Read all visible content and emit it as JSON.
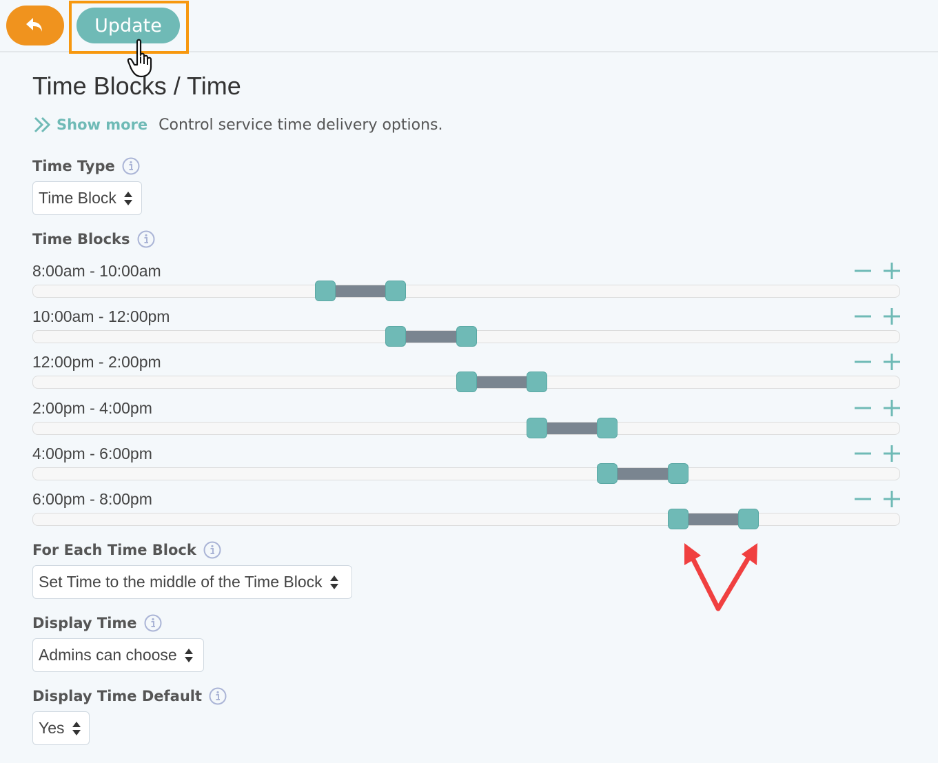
{
  "toolbar": {
    "update_label": "Update"
  },
  "page": {
    "title": "Time Blocks / Time",
    "show_more": "Show more",
    "description": "Control service time delivery options."
  },
  "time_type": {
    "label": "Time Type",
    "value": "Time Block"
  },
  "time_blocks": {
    "label": "Time Blocks",
    "range_hours": [
      0,
      24
    ],
    "items": [
      {
        "label": "8:00am - 10:00am",
        "start": 8,
        "end": 10
      },
      {
        "label": "10:00am - 12:00pm",
        "start": 10,
        "end": 12
      },
      {
        "label": "12:00pm - 2:00pm",
        "start": 12,
        "end": 14
      },
      {
        "label": "2:00pm - 4:00pm",
        "start": 14,
        "end": 16
      },
      {
        "label": "4:00pm - 6:00pm",
        "start": 16,
        "end": 18
      },
      {
        "label": "6:00pm - 8:00pm",
        "start": 18,
        "end": 20
      }
    ]
  },
  "for_each": {
    "label": "For Each Time Block",
    "value": "Set Time to the middle of the Time Block"
  },
  "display_time": {
    "label": "Display Time",
    "value": "Admins can choose"
  },
  "display_time_default": {
    "label": "Display Time Default",
    "value": "Yes"
  },
  "colors": {
    "accent": "#6fbab6",
    "back_button": "#f0931e",
    "highlight": "#f7980f",
    "range_fill": "#7a8590",
    "annotation": "#f04040"
  }
}
